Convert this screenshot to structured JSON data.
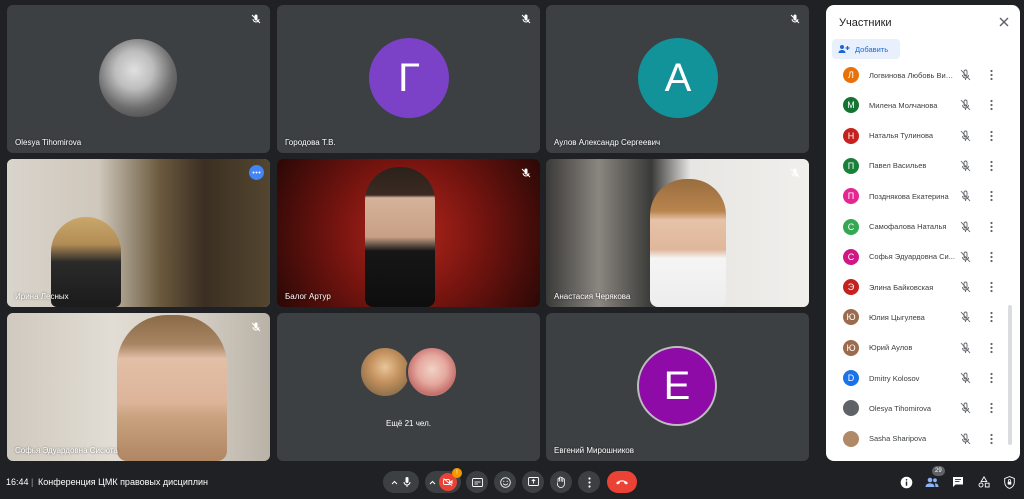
{
  "tiles": [
    {
      "name": "Olesya Tihomirova"
    },
    {
      "name": "Городова Т.В.",
      "letter": "Г",
      "color": "#7b42c8"
    },
    {
      "name": "Аулов Александр Сергеевич",
      "letter": "А",
      "color": "#12939a"
    },
    {
      "name": "Ирина Лесных"
    },
    {
      "name": "Балог Артур"
    },
    {
      "name": "Анастасия Черякова"
    },
    {
      "name": "Софья Эдуардовна Сисюта"
    },
    {
      "name": "Ещё 21 чел."
    },
    {
      "name": "Евгений Мирошников",
      "letter": "Е",
      "color": "#8e0ba8"
    }
  ],
  "panel": {
    "title": "Участники",
    "add_label": "Добавить",
    "participants": [
      {
        "initial": "Л",
        "name": "Логвинова Любовь Вик...",
        "color": "#e8710a"
      },
      {
        "initial": "М",
        "name": "Милена Молчанова",
        "color": "#137333"
      },
      {
        "initial": "Н",
        "name": "Наталья Тулинова",
        "color": "#c5221f"
      },
      {
        "initial": "П",
        "name": "Павел Васильев",
        "color": "#188038"
      },
      {
        "initial": "П",
        "name": "Позднякова Екатерина",
        "color": "#e52592"
      },
      {
        "initial": "С",
        "name": "Самофалова Наталья",
        "color": "#34a853"
      },
      {
        "initial": "С",
        "name": "Софья Эдуардовна Си...",
        "color": "#d01884"
      },
      {
        "initial": "Э",
        "name": "Элина Байковская",
        "color": "#c5221f"
      },
      {
        "initial": "Ю",
        "name": "Юлия Цыгулева",
        "color": "#9c6b4e"
      },
      {
        "initial": "Ю",
        "name": "Юрий Аулов",
        "color": "#9c6b4e"
      },
      {
        "initial": "D",
        "name": "Dmitry Kolosov",
        "color": "#1a73e8"
      },
      {
        "initial": "",
        "name": "Olesya Tihomirova",
        "color": "#5f6368"
      },
      {
        "initial": "",
        "name": "Sasha Sharipova",
        "color": "#b08968"
      }
    ]
  },
  "bottom": {
    "time": "16:44",
    "separator": "|",
    "meeting_title": "Конференция ЦМК правовых дисциплин",
    "participants_count": "29",
    "notification_count": "!"
  },
  "colors": {
    "background": "#202124",
    "tile": "#3c4043",
    "end_call": "#ea4335",
    "accent": "#1a73e8"
  }
}
